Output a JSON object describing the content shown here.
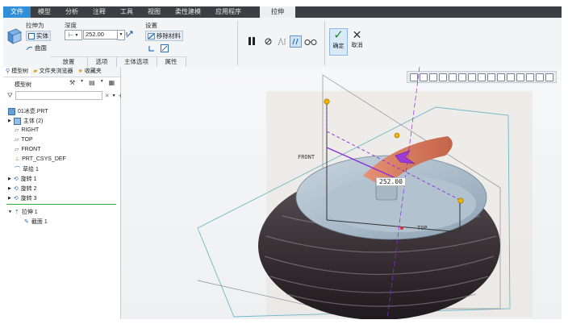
{
  "ribbon_tabs": [
    "文件",
    "模型",
    "分析",
    "注释",
    "工具",
    "视图",
    "柔性建模",
    "应用程序"
  ],
  "active_tab": "拉伸",
  "extrude": {
    "extrude_as_label": "拉伸为",
    "solid_label": "实体",
    "surface_label": "曲面",
    "depth_label": "深度",
    "depth_value": "252.00",
    "settings_label": "设置",
    "remove_material_label": "移除材料"
  },
  "confirm": {
    "ok_label": "确定",
    "cancel_label": "取消"
  },
  "groups": [
    "放置",
    "选项",
    "主体选项",
    "属性"
  ],
  "panel": {
    "tab_model_tree": "模型树",
    "tab_folder": "文件夹浏览器",
    "tab_favorites": "收藏夹",
    "header": "模型树",
    "search_placeholder": ""
  },
  "tree": [
    {
      "label": "01冰壶.PRT",
      "icon": "part-icon"
    },
    {
      "label": "主体 (2)",
      "icon": "body-icon"
    },
    {
      "label": "RIGHT",
      "icon": "plane-icon"
    },
    {
      "label": "TOP",
      "icon": "plane-icon"
    },
    {
      "label": "FRONT",
      "icon": "plane-icon"
    },
    {
      "label": "PRT_CSYS_DEF",
      "icon": "csys-icon"
    },
    {
      "label": "草绘 1",
      "icon": "sketch-icon"
    },
    {
      "label": "旋转 1",
      "icon": "revolve-icon"
    },
    {
      "label": "旋转 2",
      "icon": "revolve-icon"
    },
    {
      "label": "旋转 3",
      "icon": "revolve-icon"
    },
    {
      "label": "拉伸 1",
      "icon": "extrude-icon"
    },
    {
      "label": "截面 1",
      "icon": "section-icon"
    }
  ],
  "viewport": {
    "front_label": "FRONT",
    "top_label": "TOP",
    "dimension_value": "252.00"
  },
  "colors": {
    "accent_blue": "#2f8fd8",
    "tab_dark": "#3b3f43",
    "dim_purple": "#8a2be2",
    "handle_yellow": "#f0b400"
  }
}
